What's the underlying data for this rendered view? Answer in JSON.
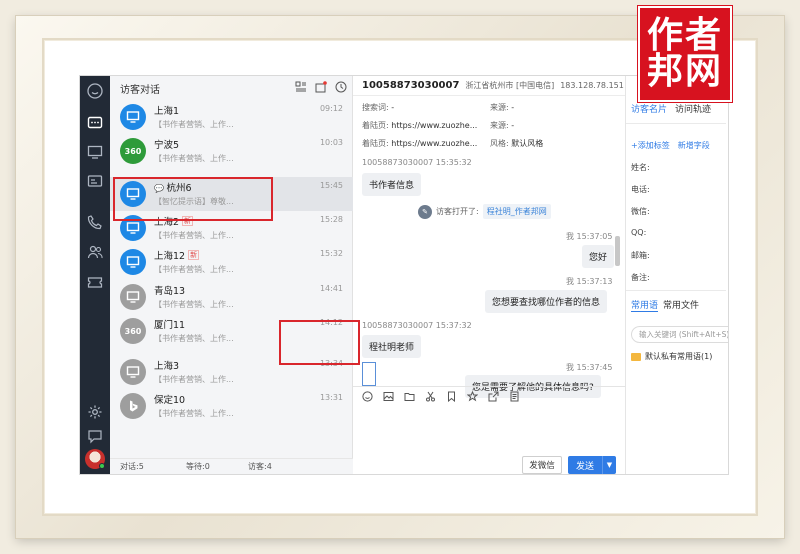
{
  "logo": {
    "line1": "作者",
    "line2": "邦网",
    "color": "#d7121f"
  },
  "visitor_list": {
    "title": "访客对话",
    "items": [
      {
        "name": "上海1",
        "time": "09:12",
        "msg": "【书作者营销、上作...",
        "avatar": "monitor-icon",
        "color": "#1e88e5",
        "new": ""
      },
      {
        "name": "宁波5",
        "time": "10:03",
        "msg": "【书作者营销、上作...",
        "avatar": "360-icon",
        "color": "#2e9b3a",
        "new": ""
      },
      {
        "name": "杭州6",
        "time": "15:45",
        "msg": "【智忆提示语】尊敬...",
        "avatar": "monitor-icon",
        "color": "#1e88e5",
        "new": ""
      },
      {
        "name": "上海2",
        "time": "15:28",
        "msg": "【书作者营销、上作...",
        "avatar": "monitor-icon",
        "color": "#1e88e5",
        "new": "新"
      },
      {
        "name": "上海12",
        "time": "15:32",
        "msg": "【书作者营销、上作...",
        "avatar": "monitor-icon",
        "color": "#1e88e5",
        "new": "新"
      },
      {
        "name": "青岛13",
        "time": "14:41",
        "msg": "【书作者营销、上作...",
        "avatar": "monitor-icon",
        "color": "#9e9e9e",
        "new": ""
      },
      {
        "name": "厦门11",
        "time": "14:12",
        "msg": "【书作者营销、上作...",
        "avatar": "360-icon",
        "color": "#9e9e9e",
        "new": ""
      },
      {
        "name": "上海3",
        "time": "13:34",
        "msg": "【书作者营销、上作...",
        "avatar": "monitor-icon",
        "color": "#9e9e9e",
        "new": ""
      },
      {
        "name": "保定10",
        "time": "13:31",
        "msg": "【书作者营销、上作...",
        "avatar": "bing-icon",
        "color": "#9e9e9e",
        "new": ""
      }
    ],
    "footer": {
      "chat": "对话:5",
      "wait": "等待:0",
      "visitor": "访客:4"
    }
  },
  "chat": {
    "visitor_id": "10058873030007",
    "location": "浙江省杭州市 [中国电信]",
    "ip": "183.128.78.151",
    "info": {
      "search_label": "搜索词:",
      "search_val": "-",
      "source_label": "来源:",
      "source_val": "-",
      "entry_label": "着陆页:",
      "entry_val": "https://www.zuozhe...",
      "referrer_label": "来源:",
      "referrer_val": "-",
      "landing_label": "着陆页:",
      "landing_val": "https://www.zuozhe...",
      "style_label": "风格:",
      "style_val": "默认风格"
    },
    "messages": {
      "ts1": "10058873030007 15:35:32",
      "m1": "书作者信息",
      "sys_prefix": "访客打开了:",
      "sys_link": "程社明_作者邦网",
      "ts2": "我 15:37:05",
      "m2": "您好",
      "ts3": "我 15:37:13",
      "m3": "您想要查找哪位作者的信息",
      "ts4": "10058873030007 15:37:32",
      "m4": "程社明老师",
      "ts5": "我 15:37:45",
      "m5": "您是需要了解他的具体信息吗?"
    },
    "buttons": {
      "wechat": "发微信",
      "send": "发送"
    }
  },
  "right_panel": {
    "tab_card": "访客名片",
    "tab_track": "访问轨迹",
    "add_tag": "+添加标签",
    "add_field": "新增字段",
    "fields": [
      "姓名:",
      "电话:",
      "微信:",
      "QQ:",
      "邮箱:",
      "备注:"
    ],
    "tab_phrases": "常用语",
    "tab_files": "常用文件",
    "search_placeholder": "输入关键词 (Shift+Alt+S)",
    "folder": "默认私有常用语(1)"
  }
}
